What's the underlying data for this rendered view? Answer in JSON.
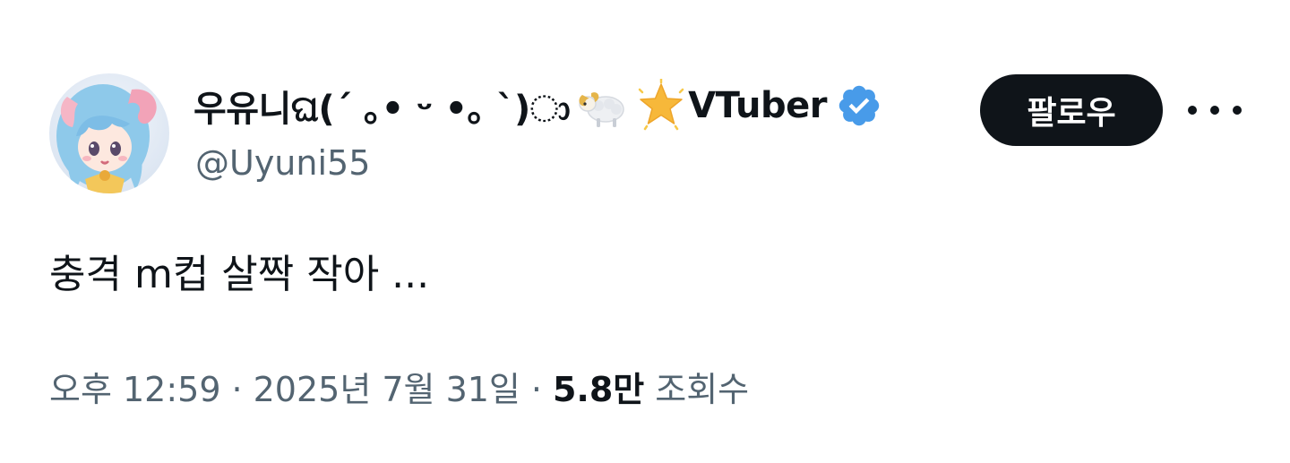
{
  "user": {
    "display_name": "우유니ଘ(´ ｡• ᵕ •｡ `)ා",
    "emoji_1": "ram-emoji",
    "emoji_2": "glowing-star-emoji",
    "tag": "VTuber",
    "handle": "@Uyuni55",
    "verified_icon": "verified-badge-icon",
    "verified_color": "#489be9"
  },
  "actions": {
    "follow_label": "팔로우",
    "more_icon": "more-options-icon"
  },
  "tweet": {
    "text": "충격 m컵 살짝 작아 ..."
  },
  "meta": {
    "time": "오후 12:59",
    "separator": "·",
    "date": "2025년 7월 31일",
    "views_count": "5.8만",
    "views_label": "조회수"
  },
  "colors": {
    "text_primary": "#0f1419",
    "text_secondary": "#536471",
    "follow_bg": "#0f1419",
    "follow_fg": "#ffffff"
  }
}
